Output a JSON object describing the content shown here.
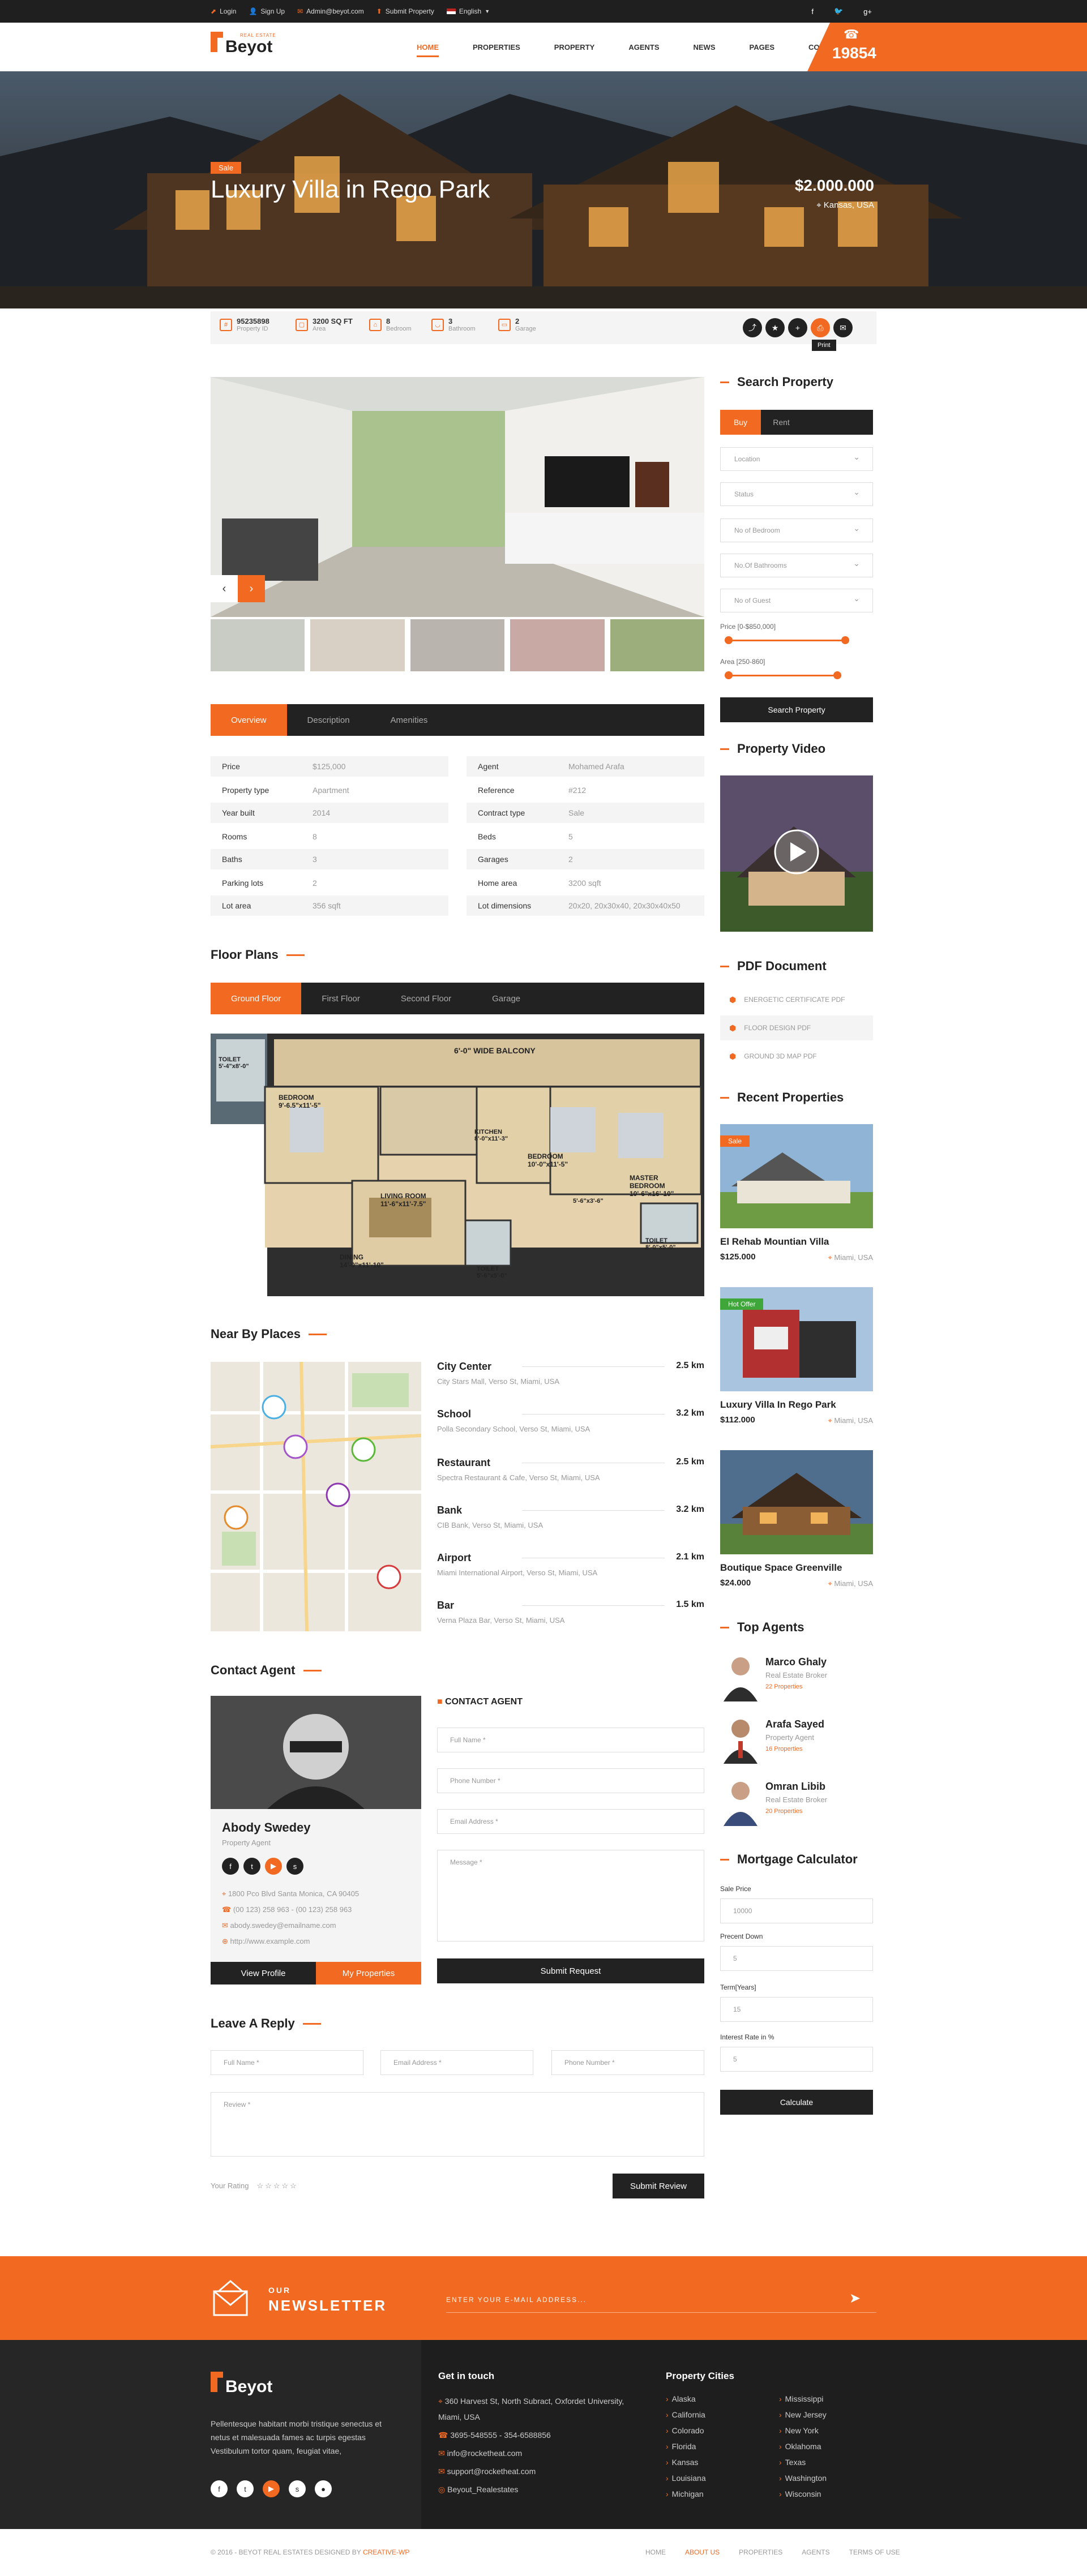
{
  "topbar": {
    "login": "Login",
    "signup": "Sign Up",
    "email": "Admin@beyot.com",
    "submit": "Submit Property",
    "language": "English"
  },
  "header": {
    "logo_name": "Beyot",
    "logo_tag": "REAL ESTATE",
    "nav": [
      "HOME",
      "PROPERTIES",
      "PROPERTY",
      "AGENTS",
      "NEWS",
      "PAGES",
      "CONTACT"
    ],
    "phone": "19854"
  },
  "hero": {
    "badge": "Sale",
    "title": "Luxury Villa in Rego Park",
    "price": "$2.000.000",
    "location": "Kansas, USA"
  },
  "stats": [
    {
      "value": "95235898",
      "label": "Property ID"
    },
    {
      "value": "3200 SQ FT",
      "label": "Area"
    },
    {
      "value": "8",
      "label": "Bedroom"
    },
    {
      "value": "3",
      "label": "Bathroom"
    },
    {
      "value": "2",
      "label": "Garage"
    }
  ],
  "print_tip": "Print",
  "tabs": [
    "Overview",
    "Description",
    "Amenities"
  ],
  "overview_left": [
    {
      "k": "Price",
      "v": "$125,000"
    },
    {
      "k": "Property type",
      "v": "Apartment"
    },
    {
      "k": "Year built",
      "v": "2014"
    },
    {
      "k": "Rooms",
      "v": "8"
    },
    {
      "k": "Baths",
      "v": "3"
    },
    {
      "k": "Parking lots",
      "v": "2"
    },
    {
      "k": "Lot area",
      "v": "356 sqft"
    }
  ],
  "overview_right": [
    {
      "k": "Agent",
      "v": "Mohamed Arafa"
    },
    {
      "k": "Reference",
      "v": "#212"
    },
    {
      "k": "Contract type",
      "v": "Sale"
    },
    {
      "k": "Beds",
      "v": "5"
    },
    {
      "k": "Garages",
      "v": "2"
    },
    {
      "k": "Home area",
      "v": "3200 sqft"
    },
    {
      "k": "Lot dimensions",
      "v": "20x20, 20x30x40, 20x30x40x50"
    }
  ],
  "floor_plans": {
    "title": "Floor Plans",
    "tabs": [
      "Ground Floor",
      "First Floor",
      "Second Floor",
      "Garage"
    ],
    "labels": [
      "6'-0\" WIDE BALCONY",
      "TOILET 5'-4\"x8'-0\"",
      "BEDROOM 9'-6.5\"x11'-5\"",
      "KITCHEN 8'-0\"x11'-3\"",
      "BEDROOM 10'-0\"x11'-5\"",
      "MASTER BEDROOM 10'-6\"x16'-10\"",
      "LIVING ROOM 11'-6\"x11'-7.5\"",
      "5'-6\"x3'-6\"",
      "TOILET 8'-0\"x5'-0\"",
      "DINING 14'-0\"x11'-10\"",
      "TOILET 5'-6\"x5'-0\""
    ]
  },
  "nearby": {
    "title": "Near By Places",
    "places": [
      {
        "name": "City Center",
        "dist": "2.5 km",
        "addr": "City Stars Mall, Verso St, Miami, USA"
      },
      {
        "name": "School",
        "dist": "3.2 km",
        "addr": "Polla Secondary School, Verso St, Miami, USA"
      },
      {
        "name": "Restaurant",
        "dist": "2.5 km",
        "addr": "Spectra Restaurant & Cafe, Verso St, Miami, USA"
      },
      {
        "name": "Bank",
        "dist": "3.2 km",
        "addr": "CIB Bank, Verso St, Miami, USA"
      },
      {
        "name": "Airport",
        "dist": "2.1 km",
        "addr": "Miami International Airport, Verso St, Miami, USA"
      },
      {
        "name": "Bar",
        "dist": "1.5 km",
        "addr": "Verna Plaza Bar, Verso St, Miami, USA"
      }
    ]
  },
  "contact": {
    "title": "Contact Agent",
    "agent_name": "Abody Swedey",
    "agent_role": "Property Agent",
    "address": "1800 Pco Blvd Santa Monica, CA 90405",
    "phone": "(00 123) 258 963 - (00 123) 258 963",
    "email": "abody.swedey@emailname.com",
    "web": "http://www.example.com",
    "view_profile": "View Profile",
    "my_properties": "My Properties",
    "form_title": "CONTACT AGENT",
    "full_name": "Full Name *",
    "phone_number": "Phone Number *",
    "email_address": "Email Address *",
    "message": "Message *",
    "submit": "Submit Request"
  },
  "reply": {
    "title": "Leave A Reply",
    "full_name": "Full Name *",
    "email": "Email Address *",
    "phone": "Phone Number *",
    "review": "Review *",
    "rating": "Your Rating",
    "submit": "Submit Review"
  },
  "sidebar": {
    "search_title": "Search Property",
    "buy": "Buy",
    "rent": "Rent",
    "selects": [
      "Location",
      "Status",
      "No of Bedroom",
      "No.Of Bathrooms",
      "No of Guest"
    ],
    "price_label": "Price [0-$850,000]",
    "area_label": "Area [250-860]",
    "search_btn": "Search Property",
    "video_title": "Property Video",
    "pdf_title": "PDF Document",
    "pdfs": [
      "ENERGETIC CERTIFICATE PDF",
      "FLOOR DESIGN PDF",
      "GROUND 3D MAP PDF"
    ],
    "recent_title": "Recent Properties",
    "recent": [
      {
        "badge": "Sale",
        "name": "El Rehab Mountian Villa",
        "price": "$125.000",
        "loc": "Miami, USA"
      },
      {
        "badge": "Hot Offer",
        "name": "Luxury Villa In Rego Park",
        "price": "$112.000",
        "loc": "Miami, USA"
      },
      {
        "badge": "",
        "name": "Boutique Space Greenville",
        "price": "$24.000",
        "loc": "Miami, USA"
      }
    ],
    "agents_title": "Top Agents",
    "agents": [
      {
        "name": "Marco Ghaly",
        "role": "Real Estate Broker",
        "props": "22 Properties"
      },
      {
        "name": "Arafa Sayed",
        "role": "Property Agent",
        "props": "16 Properties"
      },
      {
        "name": "Omran Libib",
        "role": "Real Estate Broker",
        "props": "20 Properties"
      }
    ],
    "mortgage_title": "Mortgage Calculator",
    "sale_price_label": "Sale Price",
    "sale_price": "10000",
    "percent_label": "Precent Down",
    "percent": "5",
    "term_label": "Term[Years]",
    "term": "15",
    "interest_label": "Interest Rate in %",
    "interest": "5",
    "calculate": "Calculate"
  },
  "newsletter": {
    "our": "OUR",
    "title": "NEWSLETTER",
    "placeholder": "ENTER YOUR E-MAIL ADDRESS..."
  },
  "footer": {
    "logo_name": "Beyot",
    "about": "Pellentesque habitant morbi tristique senectus et netus et malesuada fames ac turpis egestas Vestibulum tortor quam, feugiat vitae,",
    "touch_title": "Get in touch",
    "address": "360 Harvest St, North Subract, Oxfordet University, Miami, USA",
    "phones": "3695-548555  -  354-6588856",
    "email1": "info@rocketheat.com",
    "email2": "support@rocketheat.com",
    "skype": "Beyout_Realestates",
    "cities_title": "Property Cities",
    "cities_left": [
      "Alaska",
      "California",
      "Colorado",
      "Florida",
      "Kansas",
      "Louisiana",
      "Michigan"
    ],
    "cities_right": [
      "Mississippi",
      "New Jersey",
      "New York",
      "Oklahoma",
      "Texas",
      "Washington",
      "Wisconsin"
    ]
  },
  "copyright": {
    "text_prefix": "© 2016 - BEYOT REAL ESTATES DESIGNED BY ",
    "text_brand": "CREATIVE-WP",
    "links": [
      "HOME",
      "ABOUT US",
      "PROPERTIES",
      "AGENTS",
      "TERMS OF USE"
    ]
  },
  "colors": {
    "accent": "#f26922",
    "dark": "#222222"
  }
}
